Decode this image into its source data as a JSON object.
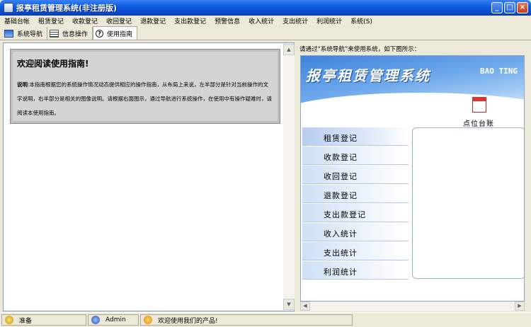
{
  "window": {
    "title": "报亭租赁管理系统(非注册版)",
    "controls": [
      "_",
      "□",
      "×"
    ]
  },
  "menu": [
    "基础台帐",
    "租赁登记",
    "收款登记",
    "收回登记",
    "退款登记",
    "支出款登记",
    "预警信息",
    "收入统计",
    "支出统计",
    "利润统计",
    "系统(S)"
  ],
  "tabs": [
    {
      "label": "系统导航",
      "icon": "nav-window-icon"
    },
    {
      "label": "信息操作",
      "icon": "info-list-icon"
    },
    {
      "label": "使用指南",
      "icon": "help-icon"
    }
  ],
  "guide": {
    "title": "欢迎阅读使用指南!",
    "label": "说明",
    "body": ":本指南根据您的系统操作情况动态提供相应的操作指南，从布局上来说，左半部分是针对当前操作的文字说明，右半部分是相关的图像说明。请根据右面图示，通过导航进行系统操作，在使用中有操作疑难时，请阅读本使用指南。"
  },
  "right_caption": "请通过“系统导航”来使用系统，如下图所示：",
  "preview": {
    "banner_title": "报亭租赁管理系统",
    "banner_en": "BAO TING",
    "calendar_label": "点位台账",
    "nav_items": [
      "租赁登记",
      "收款登记",
      "收回登记",
      "退款登记",
      "支出款登记",
      "收入统计",
      "支出统计",
      "利润统计"
    ]
  },
  "status": {
    "ready": "准备",
    "user": "Admin",
    "welcome": "欢迎使用我们的产品!"
  },
  "colors": {
    "titlebar": "#0a5be0",
    "panel": "#ece9d8",
    "guide_box": "#d4d4d4"
  }
}
